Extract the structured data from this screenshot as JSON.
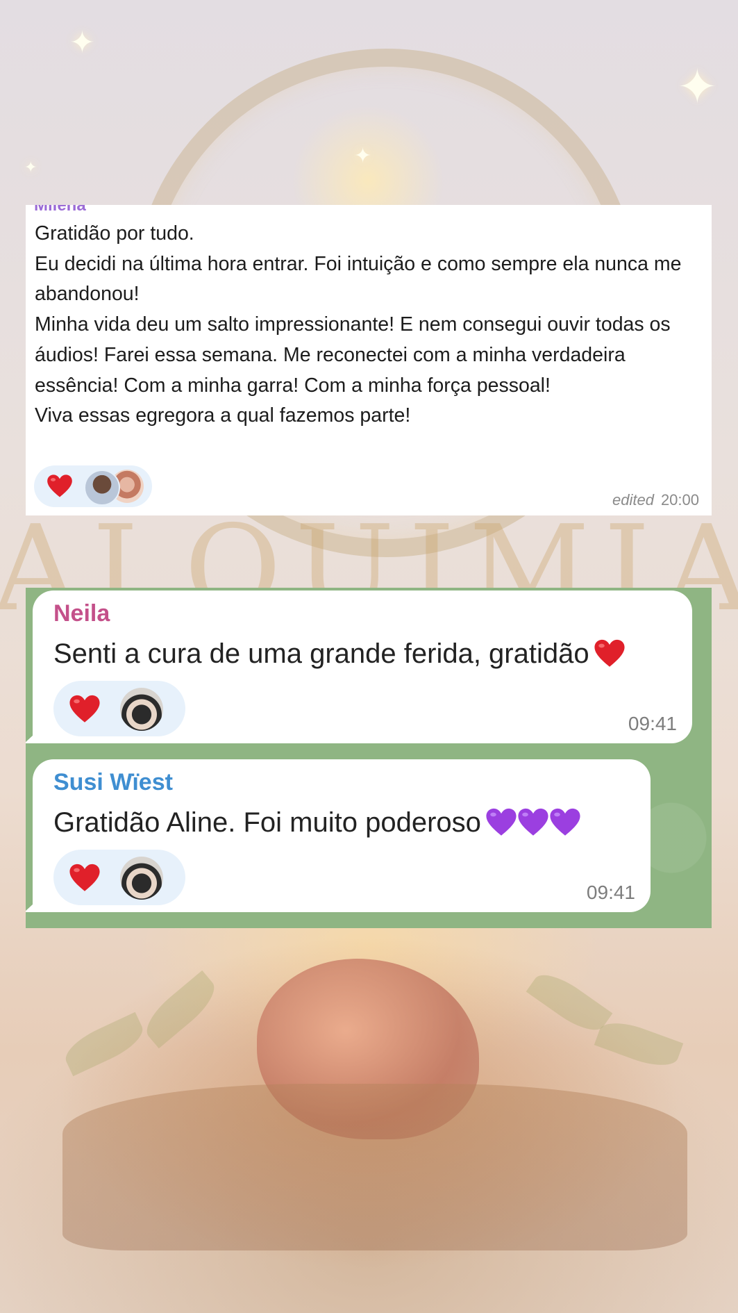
{
  "background": {
    "word": "ALQUIMIA",
    "colors": {
      "chat_green": "#8fb583",
      "bubble": "#ffffff",
      "reaction_pill": "#e7f1fb"
    }
  },
  "top_chat": {
    "sender": "Milena",
    "sender_color": "#9b6bd6",
    "message": "Gratidão por tudo.\nEu decidi na última hora entrar. Foi intuição  e como sempre ela nunca me abandonou!\nMinha vida deu um salto impressionante! E nem consegui ouvir todas os áudios! Farei essa semana. Me reconectei com a minha verdadeira essência! Com a minha garra! Com a minha força pessoal!\nViva essas egregora a qual fazemos parte!",
    "reaction": "red-heart-icon",
    "edited_label": "edited",
    "time": "20:00"
  },
  "bottom_chat": {
    "messages": [
      {
        "sender": "Neila",
        "sender_color": "#c4508a",
        "text": "Senti a cura de uma grande ferida, gratidão",
        "emoji": "red-heart-icon",
        "reaction": "red-heart-icon",
        "time": "09:41"
      },
      {
        "sender": "Susi Wïest",
        "sender_color": "#3f8ed1",
        "text": "Gratidão Aline. Foi muito poderoso",
        "emoji": "purple-heart-icon x3",
        "reaction": "red-heart-icon",
        "time": "09:41"
      }
    ]
  }
}
